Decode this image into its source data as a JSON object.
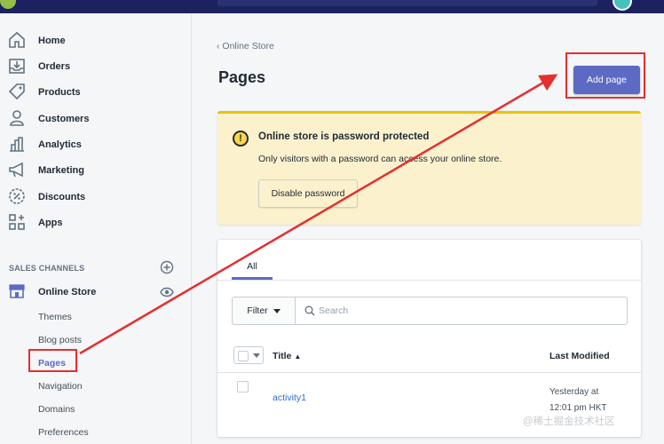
{
  "sidebar": {
    "nav": [
      {
        "label": "Home",
        "icon": "home-icon"
      },
      {
        "label": "Orders",
        "icon": "orders-icon"
      },
      {
        "label": "Products",
        "icon": "products-tag-icon"
      },
      {
        "label": "Customers",
        "icon": "customers-icon"
      },
      {
        "label": "Analytics",
        "icon": "analytics-icon"
      },
      {
        "label": "Marketing",
        "icon": "marketing-megaphone-icon"
      },
      {
        "label": "Discounts",
        "icon": "discounts-icon"
      },
      {
        "label": "Apps",
        "icon": "apps-icon"
      }
    ],
    "sales_channels_label": "SALES CHANNELS",
    "online_store_label": "Online Store",
    "sub_items": [
      "Themes",
      "Blog posts",
      "Pages",
      "Navigation",
      "Domains",
      "Preferences"
    ],
    "active_sub_item": "Pages"
  },
  "main": {
    "breadcrumb": "Online Store",
    "breadcrumb_chevron": "‹",
    "title": "Pages",
    "add_button": "Add page",
    "banner": {
      "title": "Online store is password protected",
      "text": "Only visitors with a password can access your online store.",
      "button": "Disable password",
      "icon_glyph": "!"
    },
    "tabs": [
      {
        "label": "All",
        "selected": true
      }
    ],
    "filter_label": "Filter",
    "search_placeholder": "Search",
    "table": {
      "columns": [
        "Title",
        "Last Modified"
      ],
      "sort_glyph": "▲",
      "rows": [
        {
          "title": "activity1",
          "modified_line1": "Yesterday at",
          "modified_line2": "12:01 pm HKT"
        }
      ]
    }
  },
  "watermark": "@稀土掘金技术社区",
  "colors": {
    "accent": "#5c6ac4",
    "annotation_red": "#e62e2e",
    "banner_bg": "#fcf1cd",
    "banner_border": "#eec200",
    "link": "#2c6ecb"
  }
}
